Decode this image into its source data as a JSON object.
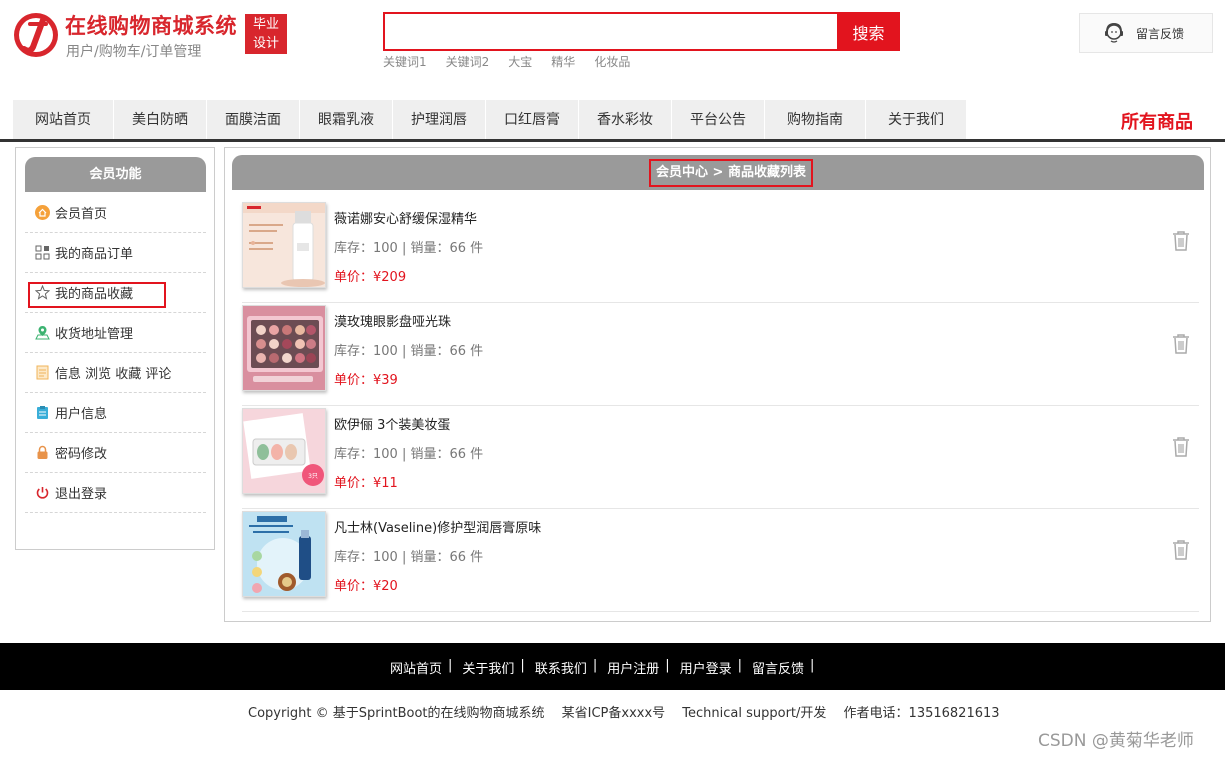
{
  "header": {
    "title": "在线购物商城系统",
    "subtitle": "用户/购物车/订单管理",
    "badge_line1": "毕业",
    "badge_line2": "设计",
    "search_button": "搜索",
    "search_value": "",
    "hot_keywords": [
      "关键词1",
      "关键词2",
      "大宝",
      "精华",
      "化妆品"
    ],
    "feedback": "留言反馈",
    "brand_color": "#e2141e"
  },
  "nav": {
    "items": [
      "网站首页",
      "美白防晒",
      "面膜洁面",
      "眼霜乳液",
      "护理润唇",
      "口红唇膏",
      "香水彩妆",
      "平台公告",
      "购物指南",
      "关于我们"
    ],
    "all_products": "所有商品"
  },
  "sidebar": {
    "title": "会员功能",
    "items": [
      {
        "label": "会员首页",
        "icon": "home-icon"
      },
      {
        "label": "我的商品订单",
        "icon": "grid-icon"
      },
      {
        "label": "我的商品收藏",
        "icon": "star-icon"
      },
      {
        "label": "收货地址管理",
        "icon": "map-pin-icon"
      },
      {
        "label": "信息 浏览 收藏 评论",
        "icon": "document-icon"
      },
      {
        "label": "用户信息",
        "icon": "clipboard-icon"
      },
      {
        "label": "密码修改",
        "icon": "lock-icon"
      },
      {
        "label": "退出登录",
        "icon": "power-icon"
      }
    ]
  },
  "main": {
    "breadcrumb": "会员中心 > 商品收藏列表",
    "favorites": [
      {
        "name": "薇诺娜安心舒缓保湿精华",
        "stock": "库存：100 | 销量：66 件",
        "price": "单价：¥209"
      },
      {
        "name": "漠玫瑰眼影盘哑光珠",
        "stock": "库存：100 | 销量：66 件",
        "price": "单价：¥39"
      },
      {
        "name": "欧伊俪 3个装美妆蛋",
        "stock": "库存：100 | 销量：66 件",
        "price": "单价：¥11"
      },
      {
        "name": "凡士林(Vaseline)修护型润唇膏原味",
        "stock": "库存：100 | 销量：66 件",
        "price": "单价：¥20"
      }
    ]
  },
  "footer": {
    "links": [
      "网站首页",
      "关于我们",
      "联系我们",
      "用户注册",
      "用户登录",
      "留言反馈"
    ],
    "copyright": "Copyright © 基于SprintBoot的在线购物商城系统 　某省ICP备xxxx号 　Technical support/开发 　作者电话：13516821613",
    "watermark": "CSDN @黄菊华老师"
  }
}
